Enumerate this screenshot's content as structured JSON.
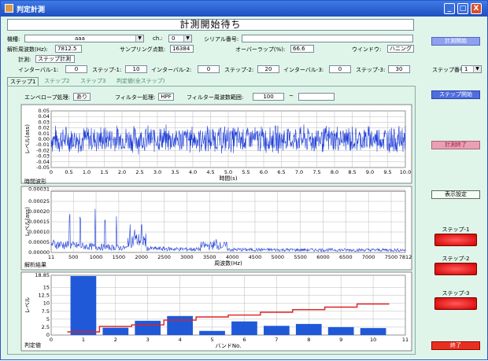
{
  "window": {
    "title": "判定計測",
    "min": "_",
    "max": "□",
    "close": "X"
  },
  "status": "計測開始待ち",
  "fields": {
    "model_label": "機種:",
    "model_value": "aaa",
    "ch_label": "ch.:",
    "ch_value": "0",
    "serial_label": "シリアル番号:",
    "serial_value": "",
    "resolution_label": "解析周波数(Hz):",
    "resolution_value": "7812.5",
    "points_label": "サンプリング点数:",
    "points_value": "16384",
    "overlap_label": "オーバーラップ(%):",
    "overlap_value": "66.6",
    "window_label": "ウインドウ:",
    "window_value": "ハニング",
    "measure_label": "計測:",
    "measure_value": "ステップ計測",
    "interval1_label": "インターバル-1:",
    "interval1_value": "0",
    "step1_label": "ステップ-1:",
    "step1_value": "10",
    "interval2_label": "インターバル-2:",
    "interval2_value": "0",
    "step2_label": "ステップ-2:",
    "step2_value": "20",
    "interval3_label": "インターバル-3:",
    "interval3_value": "0",
    "step3_label": "ステップ-3:",
    "step3_value": "30",
    "stepno_label": "ステップ番号",
    "stepno_value": "1"
  },
  "tabs": [
    "ステップ1",
    "ステップ2",
    "ステップ3",
    "判定値(全ステップ)"
  ],
  "filters": {
    "envelope_label": "エンベロープ処理:",
    "envelope_value": "あり",
    "filter_label": "フィルター処理:",
    "filter_value": "HPF",
    "range_label": "フィルター周波数範囲:",
    "range_low": "100",
    "range_sep": "~",
    "range_high": ""
  },
  "chart_data": [
    {
      "type": "line",
      "title": "時間波形",
      "xlabel": "時間(s)",
      "ylabel": "レベル(ass)",
      "xlim": [
        0,
        10
      ],
      "ylim": [
        -0.05,
        0.05
      ],
      "x_ticks": [
        "0",
        "0.5",
        "1.0",
        "1.5",
        "2.0",
        "2.5",
        "3.0",
        "3.5",
        "4.0",
        "4.5",
        "5.0",
        "5.5",
        "6.0",
        "6.5",
        "7.0",
        "7.5",
        "8.0",
        "8.5",
        "9.0",
        "9.5",
        "10.0"
      ],
      "y_ticks": [
        "0.05",
        "0.04",
        "0.03",
        "0.02",
        "0.01",
        "0.00",
        "-0.01",
        "-0.02",
        "-0.03",
        "-0.04",
        "-0.05"
      ],
      "series": [
        {
          "amplitude": 0.025,
          "color": "#1f3fd8"
        }
      ]
    },
    {
      "type": "line",
      "title": "解析結果",
      "xlabel": "周波数(Hz)",
      "ylabel": "レベル(ass)",
      "xlim": [
        11,
        7812
      ],
      "ylim": [
        0,
        0.0003
      ],
      "x_ticks": [
        "11",
        "500",
        "1000",
        "1500",
        "2000",
        "2500",
        "3000",
        "3500",
        "4000",
        "4500",
        "5000",
        "5500",
        "6000",
        "6500",
        "7000",
        "7500",
        "7812"
      ],
      "y_ticks": [
        "0.00031",
        "0.00025",
        "0.00020",
        "0.00015",
        "0.00010",
        "0.00005",
        "0.00000"
      ],
      "series": [
        {
          "color": "#1f3fd8"
        }
      ]
    },
    {
      "type": "bar",
      "title": "判定値",
      "xlabel": "バンドNo.",
      "ylabel": "レベル",
      "xlim": [
        0,
        11
      ],
      "ylim": [
        0,
        18.85
      ],
      "x_ticks": [
        "0",
        "1",
        "2",
        "3",
        "4",
        "5",
        "6",
        "7",
        "8",
        "9",
        "10",
        "11"
      ],
      "y_ticks": [
        "18.85",
        "15",
        "12.5",
        "10",
        "7.5",
        "5",
        "2.5",
        "0"
      ],
      "categories": [
        "1",
        "2",
        "3",
        "4",
        "5",
        "6",
        "7",
        "8",
        "9",
        "10"
      ],
      "series": [
        {
          "values": [
            18.6,
            2.3,
            4.5,
            6.0,
            1.3,
            4.3,
            2.9,
            3.5,
            2.5,
            2.2
          ],
          "color": "#2059d8"
        },
        {
          "values": [
            1.0,
            2.7,
            3.2,
            4.7,
            5.7,
            6.3,
            7.2,
            8.0,
            8.8,
            9.8
          ],
          "color": "#e02020"
        }
      ]
    }
  ],
  "buttons": {
    "start_measure": "計測開始",
    "start_step": "ステップ開始",
    "end_measure": "計測終了",
    "display_settings": "表示設定",
    "exit": "終了"
  },
  "leds": [
    "ステップ-1",
    "ステップ-2",
    "ステップ-3"
  ]
}
